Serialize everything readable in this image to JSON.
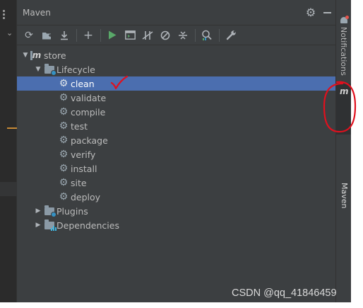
{
  "panel": {
    "title": "Maven"
  },
  "toolbar": {
    "tools": [
      {
        "icon": "reload-icon",
        "glyph": "⟳"
      },
      {
        "icon": "add-folder-icon",
        "glyph": "▣"
      },
      {
        "icon": "download-icon",
        "glyph": "⤓"
      },
      {
        "icon": "plus-icon",
        "glyph": "+"
      },
      {
        "icon": "run-icon",
        "glyph": "▶"
      },
      {
        "icon": "execute-goal-icon",
        "glyph": "▤"
      },
      {
        "icon": "toggle-offline-icon",
        "glyph": "⫽"
      },
      {
        "icon": "skip-tests-icon",
        "glyph": "⊘"
      },
      {
        "icon": "collapse-all-icon",
        "glyph": "⇕"
      },
      {
        "icon": "analyze-dependencies-icon",
        "glyph": "⌕"
      },
      {
        "icon": "settings-wrench-icon",
        "glyph": "🔧"
      }
    ]
  },
  "tree": {
    "project": "store",
    "lifecycle_label": "Lifecycle",
    "phases": [
      "clean",
      "validate",
      "compile",
      "test",
      "package",
      "verify",
      "install",
      "site",
      "deploy"
    ],
    "selected_phase": "clean",
    "plugins_label": "Plugins",
    "dependencies_label": "Dependencies"
  },
  "stripe": {
    "notifications_label": "Notifications",
    "maven_label": "Maven",
    "maven_icon": "m"
  },
  "watermark": "CSDN @qq_41846459",
  "colors": {
    "panel_bg": "#3c3f41",
    "selection": "#4b6eaf",
    "run_green": "#59a869",
    "annotation_red": "#e0101e"
  }
}
